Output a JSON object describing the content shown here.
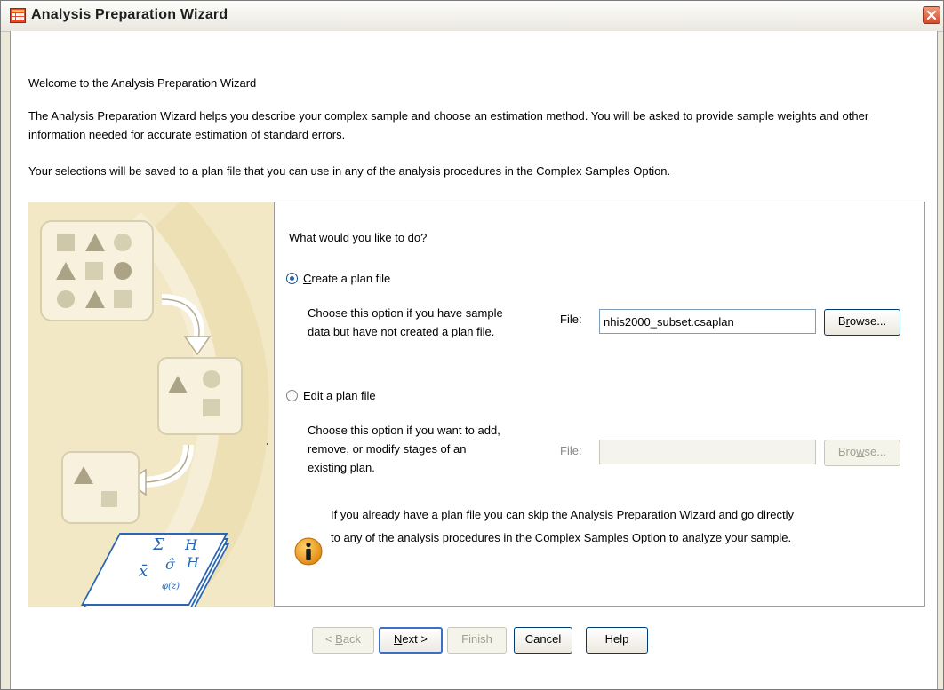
{
  "window": {
    "title": "Analysis Preparation Wizard",
    "app_icon": "spss-data-grid-icon",
    "close_icon": "close-icon"
  },
  "intro": {
    "welcome": "Welcome to the Analysis Preparation Wizard",
    "description": "The Analysis Preparation Wizard helps you describe your complex sample and choose an estimation method. You will be asked to provide sample weights and other information needed for accurate estimation of standard errors.",
    "save_note": "Your selections will be saved to a plan file that you can use in any of the analysis procedures in the Complex Samples Option."
  },
  "options": {
    "question": "What would you like to do?",
    "create": {
      "label_mnemonic": "C",
      "label_rest": "reate a plan file",
      "selected": true,
      "description_line1": "Choose this option if you have sample",
      "description_line2": "data but have not created a plan file.",
      "file_label": "File:",
      "file_value": "nhis2000_subset.csaplan",
      "browse_pre": "B",
      "browse_mnemonic": "r",
      "browse_post": "owse..."
    },
    "edit": {
      "label_mnemonic": "E",
      "label_rest": "dit a plan file",
      "selected": false,
      "description_line1": "Choose this option if you want to add,",
      "description_line2": "remove, or modify stages of an",
      "description_line3": "existing plan.",
      "file_label": "File:",
      "file_value": "",
      "browse_pre": "Bro",
      "browse_mnemonic": "w",
      "browse_post": "se..."
    },
    "info_line1": "If you already have a plan file you can skip the Analysis Preparation Wizard and go directly",
    "info_line2": "to any of the analysis procedures in the Complex Samples Option to analyze your sample.",
    "info_icon": "info-icon"
  },
  "buttons": {
    "back_prefix": "< ",
    "back_mnemonic": "B",
    "back_rest": "ack",
    "next_mnemonic": "N",
    "next_rest": "ext >",
    "finish": "Finish",
    "cancel": "Cancel",
    "help": "Help"
  },
  "colors": {
    "graphic_background": "#f2e8c6",
    "graphic_shapes": "#c9c2a4",
    "accent_blue": "#3c6fc6"
  }
}
